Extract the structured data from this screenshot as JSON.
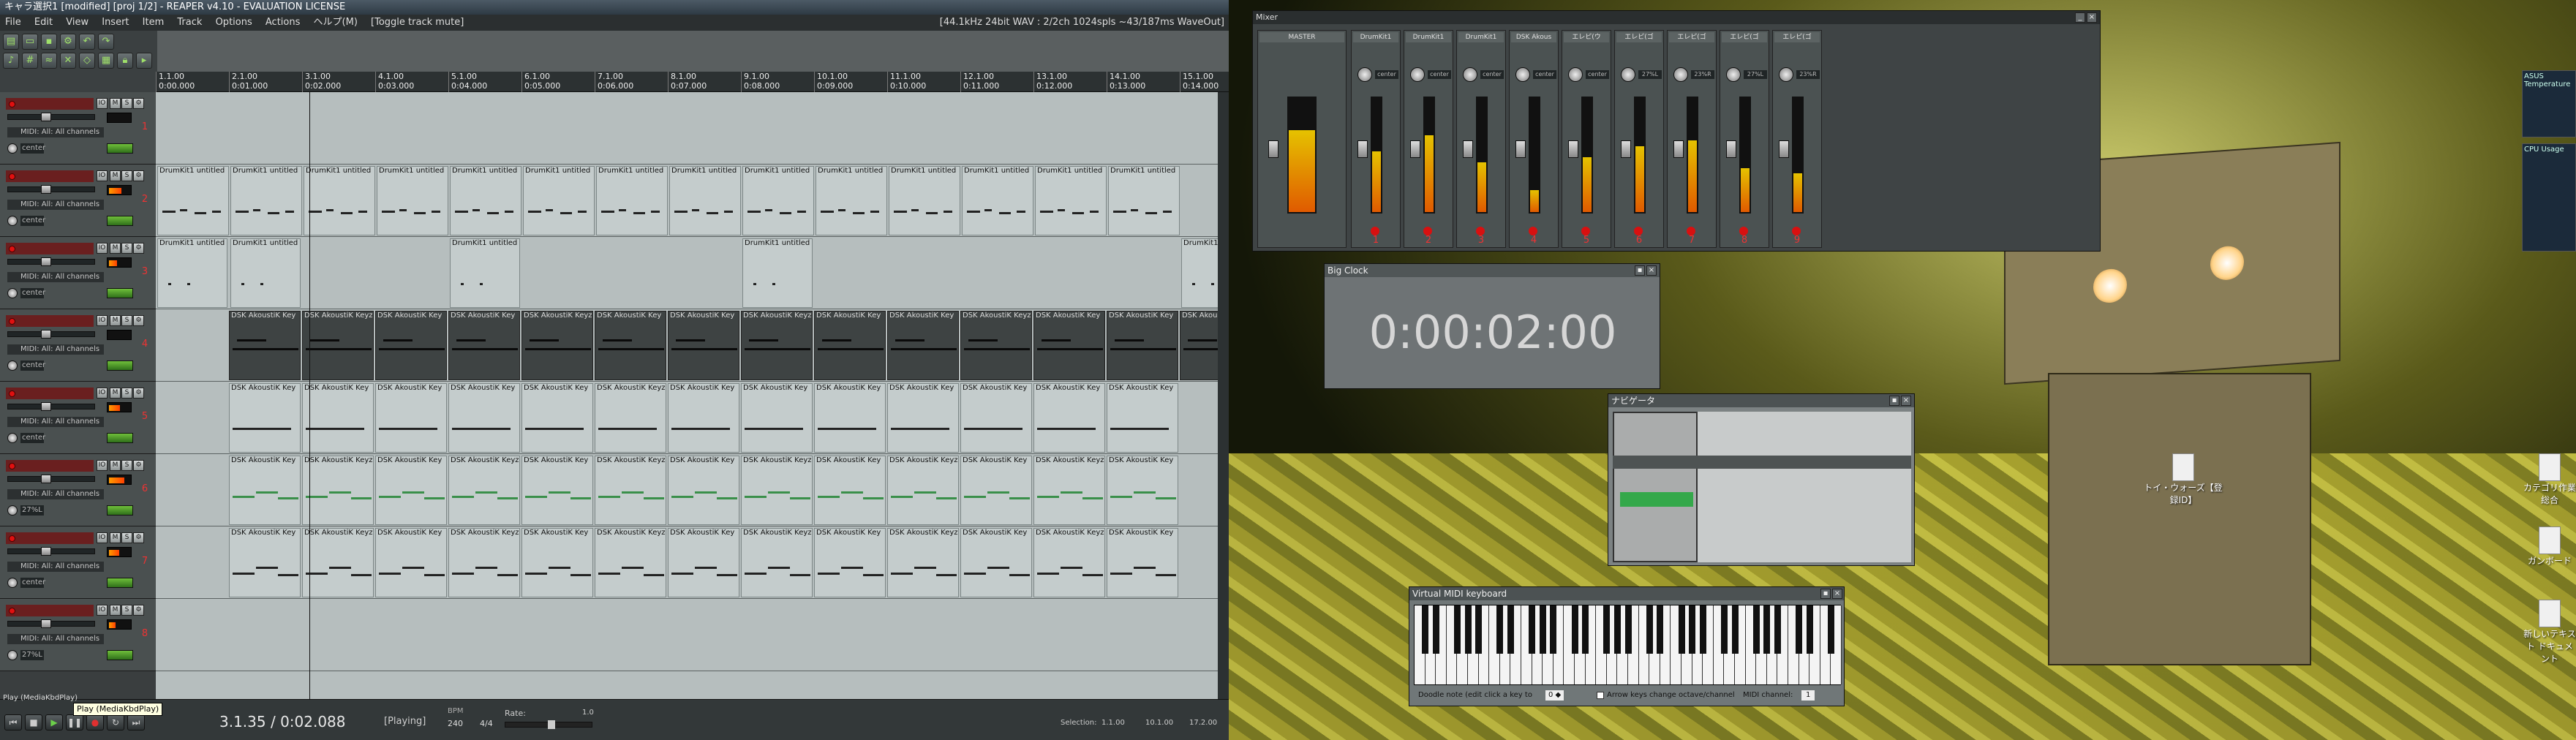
{
  "reaper": {
    "title": "キャラ選択1 [modified] [proj 1/2] - REAPER v4.10 - EVALUATION LICENSE",
    "menu": [
      "File",
      "Edit",
      "View",
      "Insert",
      "Item",
      "Track",
      "Options",
      "Actions",
      "ヘルプ(M)",
      "[Toggle track mute]"
    ],
    "audio_info": "[44.1kHz 24bit WAV : 2/2ch 1024spls ~43/187ms WaveOut]",
    "timeline_ticks": [
      {
        "bar": "1.1.00",
        "time": "0:00.000"
      },
      {
        "bar": "2.1.00",
        "time": "0:01.000"
      },
      {
        "bar": "3.1.00",
        "time": "0:02.000"
      },
      {
        "bar": "4.1.00",
        "time": "0:03.000"
      },
      {
        "bar": "5.1.00",
        "time": "0:04.000"
      },
      {
        "bar": "6.1.00",
        "time": "0:05.000"
      },
      {
        "bar": "7.1.00",
        "time": "0:06.000"
      },
      {
        "bar": "8.1.00",
        "time": "0:07.000"
      },
      {
        "bar": "9.1.00",
        "time": "0:08.000"
      },
      {
        "bar": "10.1.00",
        "time": "0:09.000"
      },
      {
        "bar": "11.1.00",
        "time": "0:10.000"
      },
      {
        "bar": "12.1.00",
        "time": "0:11.000"
      },
      {
        "bar": "13.1.00",
        "time": "0:12.000"
      },
      {
        "bar": "14.1.00",
        "time": "0:13.000"
      },
      {
        "bar": "15.1.00",
        "time": "0:14.000"
      }
    ],
    "tracks": [
      {
        "num": "1",
        "name": "",
        "midi": "MIDI: All: All channels",
        "pan": "center",
        "meter": 0.0
      },
      {
        "num": "2",
        "name": "",
        "midi": "MIDI: All: All channels",
        "pan": "center",
        "meter": 0.55
      },
      {
        "num": "3",
        "name": "",
        "midi": "MIDI: All: All channels",
        "pan": "center",
        "meter": 0.35
      },
      {
        "num": "4",
        "name": "",
        "midi": "MIDI: All: All channels",
        "pan": "center",
        "meter": 0.0
      },
      {
        "num": "5",
        "name": "",
        "midi": "MIDI: All: All channels",
        "pan": "center",
        "meter": 0.5
      },
      {
        "num": "6",
        "name": "",
        "midi": "MIDI: All: All channels",
        "pan": "27%L",
        "meter": 0.7
      },
      {
        "num": "7",
        "name": "",
        "midi": "MIDI: All: All channels",
        "pan": "center",
        "meter": 0.45
      },
      {
        "num": "8",
        "name": "",
        "midi": "MIDI: All: All channels",
        "pan": "27%L",
        "meter": 0.3
      }
    ],
    "item_labels": {
      "drumkit": "DrumKit1 untitled",
      "akoustik": "DSK AkoustiK Key",
      "akoustik_long": "DSK AkoustiK Keyz untitled MIDI item gl",
      "akoustik_glued": "DSK AkoustiK Keyz untitled MIDI item glued"
    },
    "transport": {
      "position": "3.1.35 / 0:02.088",
      "state": "[Playing]",
      "bpm_label": "BPM",
      "bpm": "240",
      "sig": "4/4",
      "rate_label": "Rate:",
      "rate": "1.0",
      "selection_label": "Selection:",
      "selection": [
        "1.1.00",
        "10.1.00",
        "17.2.00"
      ],
      "tooltip": "Play (MediaKbdPlay)",
      "play_info": "Play (MediaKbdPlay)"
    }
  },
  "mixer": {
    "title": "Mixer",
    "master_label": "MASTER",
    "strips": [
      {
        "name": "DrumKit1",
        "num": "1",
        "pan": "center",
        "level": 0.55
      },
      {
        "name": "DrumKit1",
        "num": "2",
        "pan": "center",
        "level": 0.7
      },
      {
        "name": "DrumKit1",
        "num": "3",
        "pan": "center",
        "level": 0.45
      },
      {
        "name": "DSK Akous",
        "num": "4",
        "pan": "center",
        "level": 0.2
      },
      {
        "name": "エレピ(ウ",
        "num": "5",
        "pan": "center",
        "level": 0.5
      },
      {
        "name": "エレピ(ゴ",
        "num": "6",
        "pan": "27%L",
        "level": 0.6
      },
      {
        "name": "エレピ(ゴ",
        "num": "7",
        "pan": "23%R",
        "level": 0.65
      },
      {
        "name": "エレピ(ゴ",
        "num": "8",
        "pan": "27%L",
        "level": 0.4
      },
      {
        "name": "エレピ(ゴ",
        "num": "9",
        "pan": "23%R",
        "level": 0.35
      }
    ]
  },
  "big_clock": {
    "title": "Big Clock",
    "time": "0:00:02:00"
  },
  "navigator": {
    "title": "ナビゲータ"
  },
  "vmk": {
    "title": "Virtual MIDI keyboard",
    "footer_left": "Doodle note (edit click a key to",
    "octave": "0 ◆",
    "arrow_text": "Arrow keys change octave/channel",
    "midi_channel_label": "MIDI channel:",
    "midi_channel": "1"
  },
  "desktop": {
    "file_icon_label": "トイ・ウォーズ【登録ID】",
    "right_icons": [
      "カテゴリ作業 総合",
      "ガンボード",
      "新しいテキスト ドキュメント"
    ],
    "widget_titles": [
      "ASUS Temperature",
      "CPU Usage"
    ]
  }
}
